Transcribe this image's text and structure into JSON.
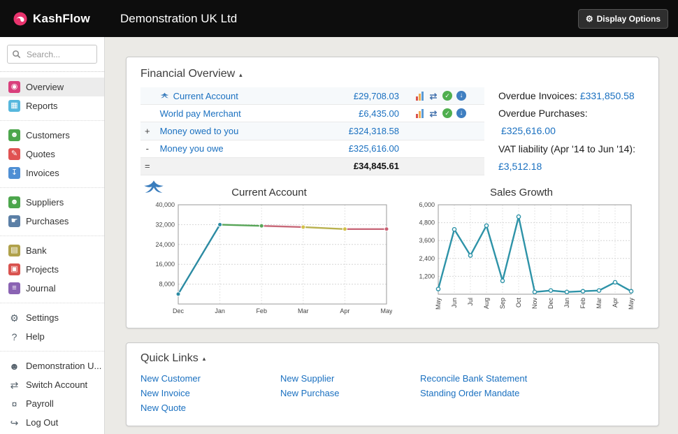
{
  "colors": {
    "link": "#1a70c0",
    "topbar_bg": "#0d0d0d",
    "accent_pink": "#e8336d"
  },
  "topbar": {
    "brand": "KashFlow",
    "company": "Demonstration UK Ltd",
    "display_options_icon": "⚙",
    "display_options_label": "Display Options"
  },
  "sidebar": {
    "search_placeholder": "Search...",
    "items": [
      {
        "label": "Overview",
        "icon": "overview-icon",
        "glyph": "◉",
        "bg": "#d93f7c",
        "selected": true
      },
      {
        "label": "Reports",
        "icon": "reports-icon",
        "glyph": "▦",
        "bg": "#56b7dd"
      },
      {
        "label": "Customers",
        "icon": "customers-icon",
        "glyph": "☻",
        "bg": "#4ca64c"
      },
      {
        "label": "Quotes",
        "icon": "quotes-icon",
        "glyph": "✎",
        "bg": "#e05252"
      },
      {
        "label": "Invoices",
        "icon": "invoices-icon",
        "glyph": "↧",
        "bg": "#4f8fd4"
      },
      {
        "label": "Suppliers",
        "icon": "suppliers-icon",
        "glyph": "☻",
        "bg": "#4ca64c"
      },
      {
        "label": "Purchases",
        "icon": "purchases-icon",
        "glyph": "☛",
        "bg": "#5b7fa6"
      },
      {
        "label": "Bank",
        "icon": "bank-icon",
        "glyph": "▤",
        "bg": "#b0a14a"
      },
      {
        "label": "Projects",
        "icon": "projects-icon",
        "glyph": "▣",
        "bg": "#d9534f"
      },
      {
        "label": "Journal",
        "icon": "journal-icon",
        "glyph": "≡",
        "bg": "#8a63b3"
      },
      {
        "label": "Settings",
        "icon": "settings-gear-icon",
        "glyph": "⚙",
        "bg": null
      },
      {
        "label": "Help",
        "icon": "help-icon",
        "glyph": "?",
        "bg": null
      },
      {
        "label": "Demonstration U...",
        "icon": "user-icon",
        "glyph": "☻",
        "bg": null
      },
      {
        "label": "Switch Account",
        "icon": "switch-account-icon",
        "glyph": "⇄",
        "bg": null
      },
      {
        "label": "Payroll",
        "icon": "payroll-icon",
        "glyph": "¤",
        "bg": null
      },
      {
        "label": "Log Out",
        "icon": "log-out-icon",
        "glyph": "↪",
        "bg": null
      }
    ]
  },
  "finance": {
    "header": "Financial Overview",
    "collapse_icon": "▴",
    "action_icons": {
      "bar_chart": "",
      "transfer": "⇄",
      "check": "✓",
      "download": "↓"
    },
    "rows": [
      {
        "prefix": "",
        "name": "Current Account",
        "amount": "£29,708.03"
      },
      {
        "prefix": "",
        "name": "World pay Merchant",
        "amount": "£6,435.00"
      },
      {
        "prefix": "+",
        "name": "Money owed to you",
        "amount": "£324,318.58"
      },
      {
        "prefix": "-",
        "name": "Money you owe",
        "amount": "£325,616.00"
      },
      {
        "prefix": "=",
        "name": "",
        "amount": "£34,845.61"
      }
    ],
    "summary": {
      "overdue_invoices_label": "Overdue Invoices:",
      "overdue_invoices_value": "£331,850.58",
      "overdue_purchases_label": "Overdue Purchases:",
      "overdue_purchases_value": "£325,616.00",
      "vat_label": "VAT liability (Apr '14 to Jun '14):",
      "vat_value": "£3,512.18"
    }
  },
  "chart_data": [
    {
      "type": "line",
      "title": "Current Account",
      "x_labels": [
        "Dec",
        "Jan",
        "Feb",
        "Mar",
        "Apr",
        "May"
      ],
      "values": [
        4000,
        32000,
        31500,
        31000,
        30200,
        30200
      ],
      "ylim": [
        0,
        40000
      ],
      "y_ticks": [
        8000,
        16000,
        24000,
        32000,
        40000
      ],
      "grid": true,
      "rotate_x": false,
      "segment_colors": [
        "#2c8ba3",
        "#57a557",
        "#c86a7a",
        "#b9b14f",
        "#c86a7a"
      ],
      "marker_colors": [
        "#2c8ba3",
        "#2c8ba3",
        "#57a557",
        "#d3c04a",
        "#d3c04a",
        "#c85f72"
      ]
    },
    {
      "type": "line",
      "title": "Sales Growth",
      "x_labels": [
        "May",
        "Jun",
        "Jul",
        "Aug",
        "Sep",
        "Oct",
        "Nov",
        "Dec",
        "Jan",
        "Feb",
        "Mar",
        "Apr",
        "May"
      ],
      "values": [
        350,
        4350,
        2600,
        4600,
        900,
        5200,
        150,
        250,
        150,
        200,
        250,
        800,
        200
      ],
      "ylim": [
        0,
        6000
      ],
      "y_ticks": [
        1200,
        2400,
        3600,
        4800,
        6000
      ],
      "grid": true,
      "rotate_x": true,
      "line_color": "#2e93a8",
      "marker": "open"
    }
  ],
  "quick_links": {
    "header": "Quick Links",
    "collapse_icon": "▴",
    "columns": [
      [
        "New Customer",
        "New Invoice",
        "New Quote"
      ],
      [
        "New Supplier",
        "New Purchase"
      ],
      [
        "Reconcile Bank Statement",
        "Standing Order Mandate"
      ]
    ]
  }
}
